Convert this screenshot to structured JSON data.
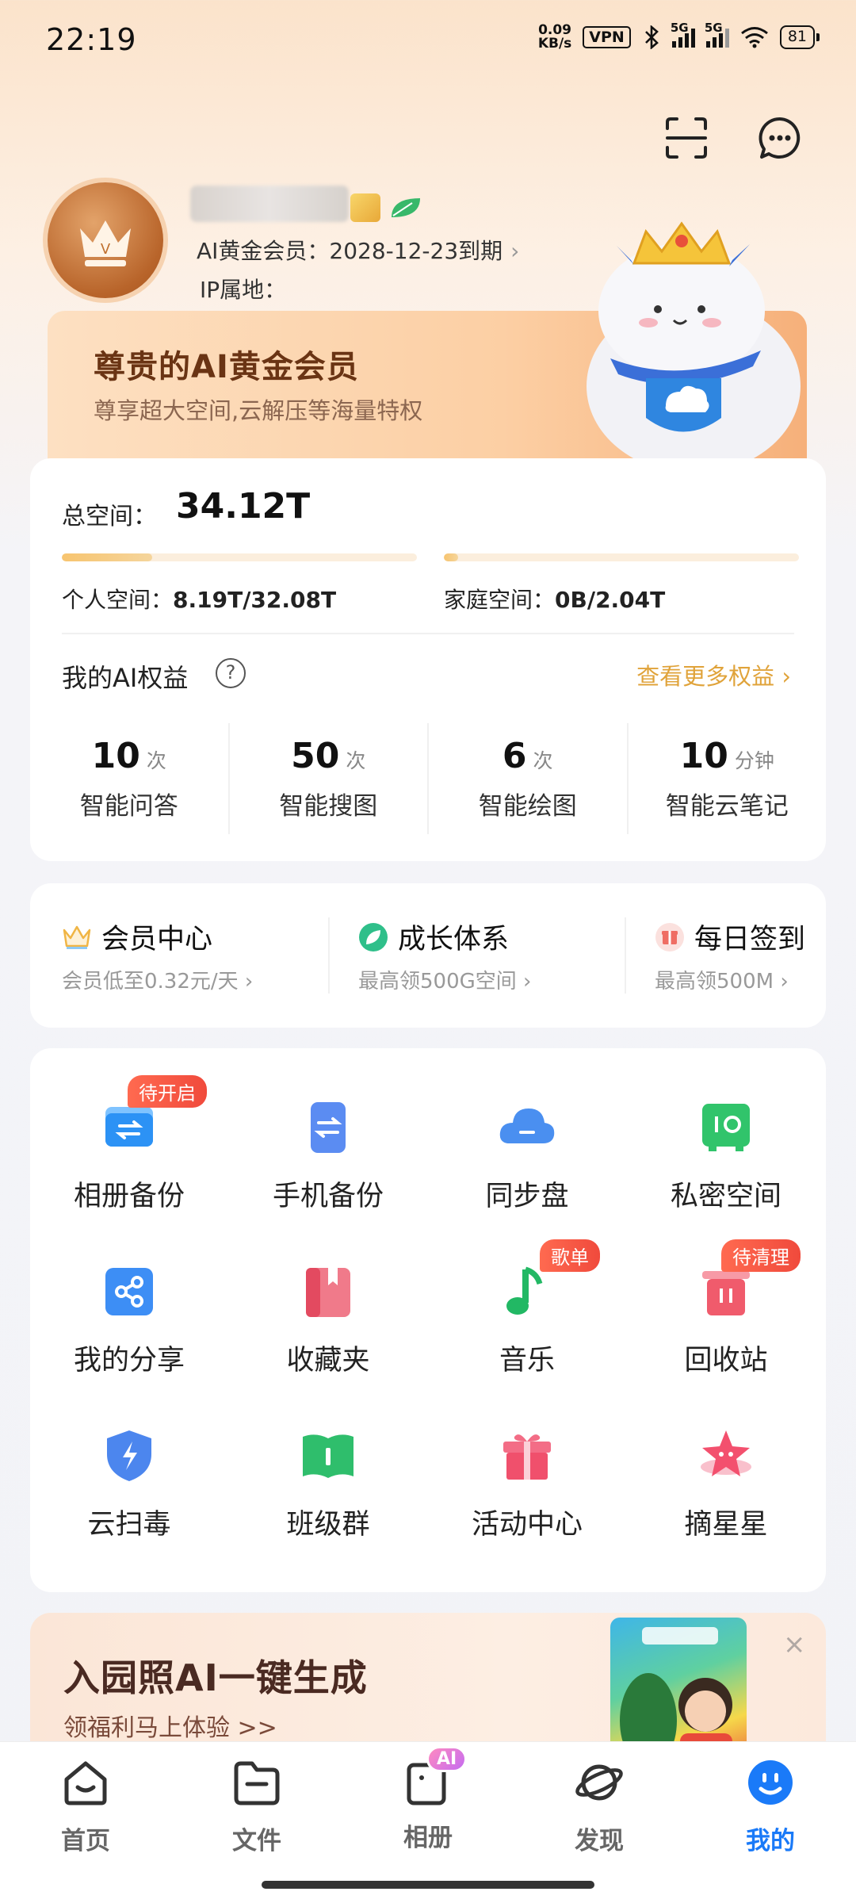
{
  "status_bar": {
    "time": "22:19",
    "net_speed_value": "0.09",
    "net_speed_unit": "KB/s",
    "vpn": "VPN",
    "signal_1": "5G",
    "signal_2": "5G",
    "battery": "81"
  },
  "profile": {
    "member_line": "AI黄金会员：2028-12-23到期",
    "ip_line": "IP属地："
  },
  "banner": {
    "title": "尊贵的AI黄金会员",
    "subtitle": "尊享超大空间,云解压等海量特权"
  },
  "storage": {
    "total_label": "总空间：",
    "total_value": "34.12T",
    "personal_label": "个人空间：",
    "personal_value": "8.19T/32.08T",
    "personal_fraction": 0.255,
    "family_label": "家庭空间：",
    "family_value": "0B/2.04T",
    "family_fraction": 0.0
  },
  "ai_rights": {
    "title": "我的AI权益",
    "more": "查看更多权益 ›",
    "items": [
      {
        "num": "10",
        "unit": "次",
        "label": "智能问答"
      },
      {
        "num": "50",
        "unit": "次",
        "label": "智能搜图"
      },
      {
        "num": "6",
        "unit": "次",
        "label": "智能绘图"
      },
      {
        "num": "10",
        "unit": "分钟",
        "label": "智能云笔记"
      }
    ]
  },
  "benefits": [
    {
      "title": "会员中心",
      "sub": "会员低至0.32元/天 ›",
      "icon": "crown-icon"
    },
    {
      "title": "成长体系",
      "sub": "最高领500G空间 ›",
      "icon": "leaf-icon"
    },
    {
      "title": "每日签到",
      "sub": "最高领500M ›",
      "icon": "gift-icon"
    }
  ],
  "grid": [
    {
      "label": "相册备份",
      "tag": "待开启",
      "icon": "album-backup-icon"
    },
    {
      "label": "手机备份",
      "tag": "",
      "icon": "phone-backup-icon"
    },
    {
      "label": "同步盘",
      "tag": "",
      "icon": "cloud-sync-icon"
    },
    {
      "label": "私密空间",
      "tag": "",
      "icon": "safe-icon"
    },
    {
      "label": "我的分享",
      "tag": "",
      "icon": "share-icon"
    },
    {
      "label": "收藏夹",
      "tag": "",
      "icon": "bookmark-icon"
    },
    {
      "label": "音乐",
      "tag": "歌单",
      "icon": "music-note-icon"
    },
    {
      "label": "回收站",
      "tag": "待清理",
      "icon": "trash-icon"
    },
    {
      "label": "云扫毒",
      "tag": "",
      "icon": "shield-icon"
    },
    {
      "label": "班级群",
      "tag": "",
      "icon": "book-icon"
    },
    {
      "label": "活动中心",
      "tag": "",
      "icon": "gift-box-icon"
    },
    {
      "label": "摘星星",
      "tag": "",
      "icon": "star-icon"
    }
  ],
  "promo": {
    "title": "入园照AI一键生成",
    "subtitle": "领福利马上体验 >>",
    "close": "×"
  },
  "nav": [
    {
      "label": "首页",
      "icon": "home-icon",
      "active": false
    },
    {
      "label": "文件",
      "icon": "folder-icon",
      "active": false
    },
    {
      "label": "相册",
      "icon": "album-icon",
      "active": false,
      "badge": "AI"
    },
    {
      "label": "发现",
      "icon": "planet-icon",
      "active": false
    },
    {
      "label": "我的",
      "icon": "smiley-icon",
      "active": true
    }
  ],
  "colors": {
    "accent_gold": "#e0a33a",
    "active_blue": "#1a7af8",
    "tag_red": "#f04a3c"
  }
}
